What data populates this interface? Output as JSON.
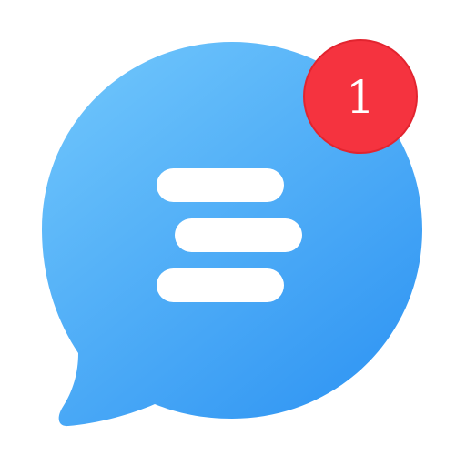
{
  "app_icon": {
    "name": "chat-bubble-icon",
    "colors": {
      "bubble_light": "#6cc3fb",
      "bubble_dark": "#3196f3",
      "lines": "#ffffff",
      "badge": "#f5333f",
      "badge_border": "#e2242f",
      "badge_text": "#ffffff"
    },
    "menu_lines": 3
  },
  "notification_badge": {
    "count": "1"
  }
}
